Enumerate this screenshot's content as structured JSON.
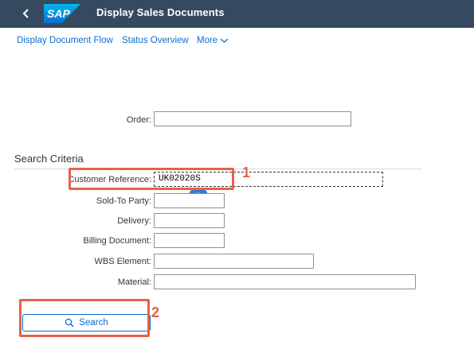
{
  "shell": {
    "logo_text": "SAP",
    "title": "Display Sales Documents"
  },
  "subnav": {
    "links": [
      "Display Document Flow",
      "Status Overview",
      "More"
    ]
  },
  "order": {
    "label": "Order:",
    "value": ""
  },
  "search_criteria": {
    "title": "Search Criteria",
    "fields": [
      {
        "label": "Customer Reference:",
        "value": "UK02020S"
      },
      {
        "label": "Sold-To Party:",
        "value": ""
      },
      {
        "label": "Delivery:",
        "value": ""
      },
      {
        "label": "Billing Document:",
        "value": ""
      },
      {
        "label": "WBS Element:",
        "value": ""
      },
      {
        "label": "Material:",
        "value": ""
      }
    ]
  },
  "search_button": {
    "label": "Search"
  },
  "annotations": [
    {
      "number": "1"
    },
    {
      "number": "2"
    }
  ],
  "colors": {
    "shellbar": "#354a5f",
    "link": "#0a6ed1",
    "annotation": "#e8604c"
  }
}
